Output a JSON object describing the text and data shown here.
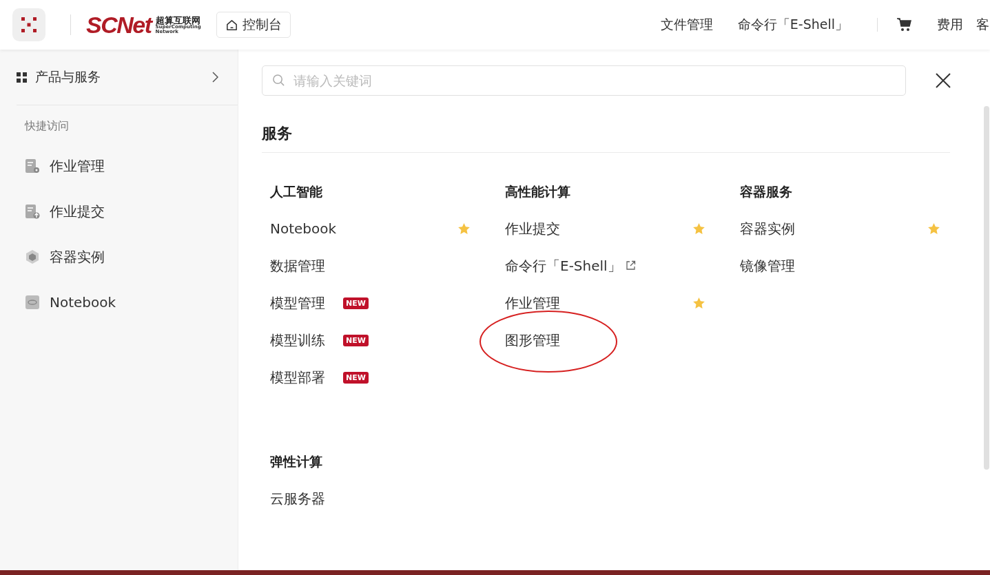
{
  "header": {
    "logo": {
      "wordmark": "SCNet",
      "cn_name": "超算互联网",
      "en_line1": "SuperComputing",
      "en_line2": "Network"
    },
    "console_button": "控制台",
    "nav_links": [
      "文件管理",
      "命令行「E-Shell」"
    ],
    "fee_link": "费用",
    "cut_link": "客"
  },
  "sidebar": {
    "products": "产品与服务",
    "section_label": "快捷访问",
    "items": [
      {
        "label": "作业管理",
        "kind": "job-settings"
      },
      {
        "label": "作业提交",
        "kind": "job-upload"
      },
      {
        "label": "容器实例",
        "kind": "container"
      },
      {
        "label": "Notebook",
        "kind": "notebook"
      }
    ]
  },
  "search": {
    "placeholder": "请输入关键词"
  },
  "section_title": "服务",
  "groups": [
    {
      "title": "人工智能",
      "items": [
        {
          "label": "Notebook",
          "favorite": true,
          "external": false,
          "circled": false
        },
        {
          "label": "数据管理",
          "favorite": false,
          "external": false,
          "circled": false
        },
        {
          "label": "模型管理",
          "favorite": false,
          "badge": "NEW",
          "external": false,
          "circled": false
        },
        {
          "label": "模型训练",
          "favorite": false,
          "badge": "NEW",
          "external": false,
          "circled": false
        },
        {
          "label": "模型部署",
          "favorite": false,
          "badge": "NEW",
          "external": false,
          "circled": false
        }
      ]
    },
    {
      "title": "高性能计算",
      "items": [
        {
          "label": "作业提交",
          "favorite": true,
          "external": false,
          "circled": false
        },
        {
          "label": "命令行「E-Shell」",
          "favorite": false,
          "external": true,
          "circled": false
        },
        {
          "label": "作业管理",
          "favorite": true,
          "external": false,
          "circled": false
        },
        {
          "label": "图形管理",
          "favorite": false,
          "external": false,
          "circled": true
        }
      ]
    },
    {
      "title": "容器服务",
      "items": [
        {
          "label": "容器实例",
          "favorite": true,
          "external": false,
          "circled": false
        },
        {
          "label": "镜像管理",
          "favorite": false,
          "external": false,
          "circled": false
        }
      ]
    },
    {
      "title": "弹性计算",
      "items": [
        {
          "label": "云服务器",
          "favorite": false,
          "external": false,
          "circled": false
        }
      ]
    }
  ]
}
